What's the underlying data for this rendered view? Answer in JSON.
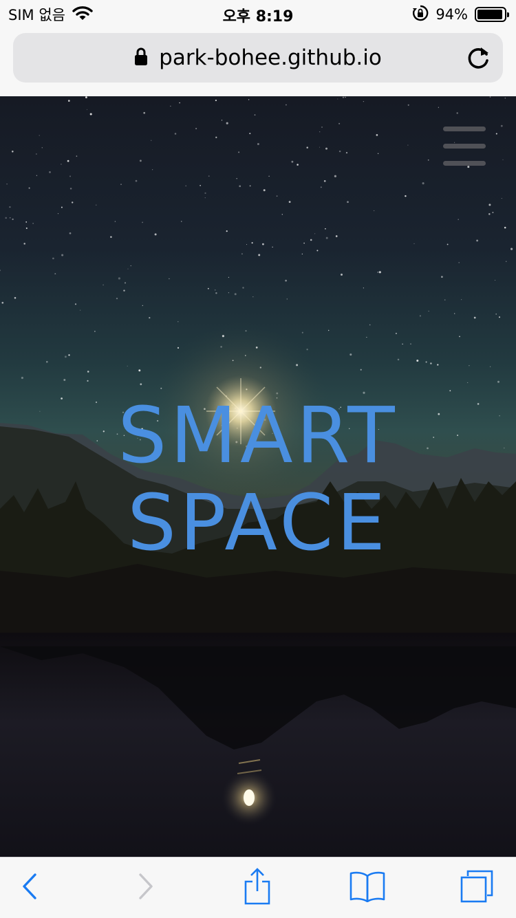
{
  "status_bar": {
    "carrier": "SIM 없음",
    "time": "오후 8:19",
    "battery_percent": "94%",
    "battery_level": 0.94,
    "icons": [
      "wifi-icon",
      "rotation-lock-icon",
      "battery-icon"
    ]
  },
  "address_bar": {
    "url": "park-bohee.github.io",
    "icons": [
      "lock-icon",
      "reload-icon"
    ]
  },
  "hero": {
    "title_line1": "SMART",
    "title_line2": "SPACE",
    "title_color": "#4a8fe0",
    "icons": [
      "menu-icon"
    ]
  },
  "toolbar": {
    "buttons": [
      {
        "name": "back",
        "icon": "chevron-left-icon",
        "enabled": true
      },
      {
        "name": "forward",
        "icon": "chevron-right-icon",
        "enabled": false
      },
      {
        "name": "share",
        "icon": "share-icon",
        "enabled": true
      },
      {
        "name": "bookmarks",
        "icon": "book-icon",
        "enabled": true
      },
      {
        "name": "tabs",
        "icon": "tabs-icon",
        "enabled": true
      }
    ],
    "accent_color": "#1a7bf2"
  }
}
